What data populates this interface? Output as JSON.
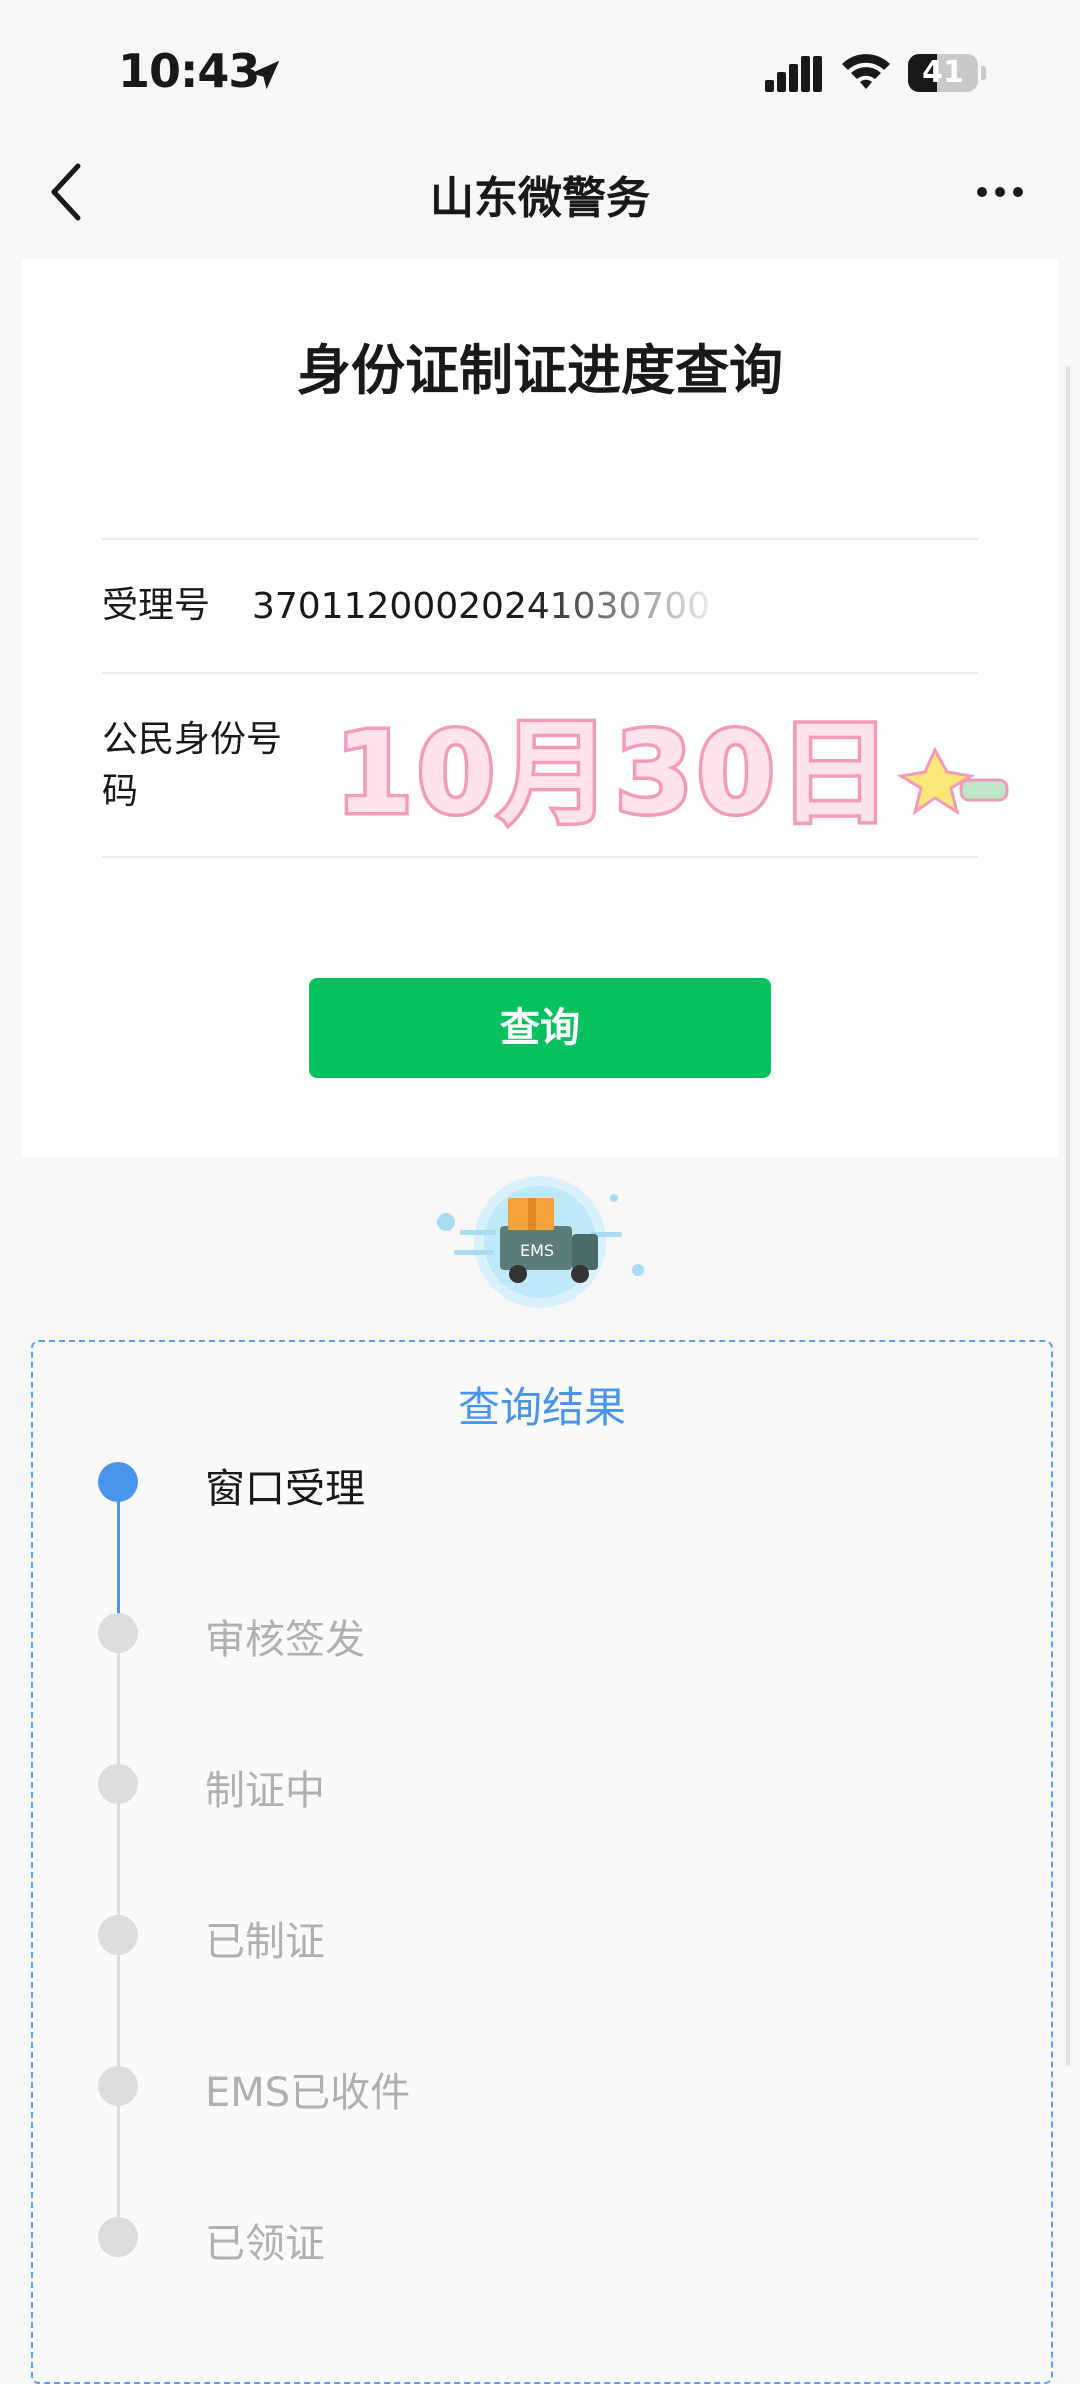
{
  "status_bar": {
    "time": "10:43",
    "battery_level": "41",
    "battery_percent": 41,
    "icons": [
      "location-arrow-icon",
      "cellular-signal-icon",
      "wifi-icon",
      "battery-icon"
    ]
  },
  "nav": {
    "title": "山东微警务",
    "back_icon": "chevron-left-icon",
    "more_icon": "more-dots-icon"
  },
  "form": {
    "page_title": "身份证制证进度查询",
    "accept_no_label": "受理号",
    "accept_no_value": "37011200020241030700",
    "id_label_line1": "公民身份号",
    "id_label_line2": "码",
    "query_button": "查询"
  },
  "sticker": {
    "text": "10月30日"
  },
  "illustration": {
    "truck_text": "EMS"
  },
  "result": {
    "title": "查询结果",
    "steps": [
      {
        "label": "窗口受理",
        "active": true
      },
      {
        "label": "审核签发",
        "active": false
      },
      {
        "label": "制证中",
        "active": false
      },
      {
        "label": "已制证",
        "active": false
      },
      {
        "label": "EMS已收件",
        "active": false
      },
      {
        "label": "已领证",
        "active": false
      }
    ]
  },
  "colors": {
    "primary_green": "#07c160",
    "accent_blue": "#4b94ec",
    "inactive_gray": "#b0b0b0"
  }
}
